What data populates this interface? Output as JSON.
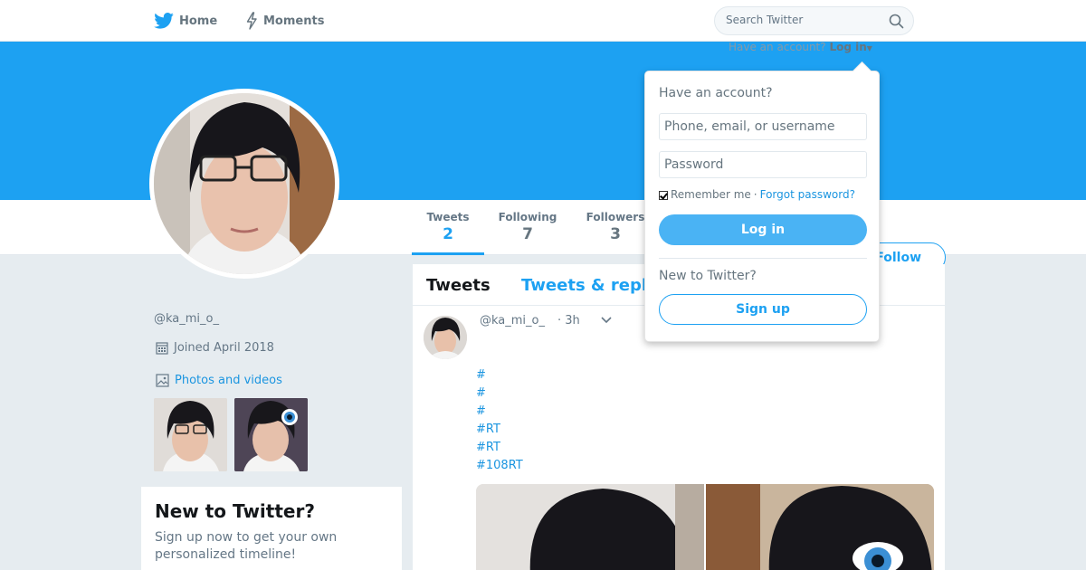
{
  "nav": {
    "home_label": "Home",
    "moments_label": "Moments",
    "search_placeholder": "Search Twitter",
    "have_account_prefix": "Have an account?",
    "login_label": "Log in"
  },
  "profile": {
    "display_name": "ㅤㅤ",
    "handle": "@ka_mi_o_",
    "joined": "Joined April 2018",
    "photos_link": "Photos and videos",
    "banner_color": "#1da1f2"
  },
  "stats": [
    {
      "label": "Tweets",
      "value": "2"
    },
    {
      "label": "Following",
      "value": "7"
    },
    {
      "label": "Followers",
      "value": "3"
    }
  ],
  "follow_button": "Follow",
  "new_card": {
    "title": "New to Twitter?",
    "text": "Sign up now to get your own personalized timeline!"
  },
  "timeline": {
    "tab_tweets": "Tweets",
    "tab_replies": "Tweets & replies",
    "tweet": {
      "handle": "@ka_mi_o_",
      "time": "· 3h",
      "lines": [
        "#",
        "#",
        "#",
        "#RT",
        "#RT",
        "#108RT"
      ]
    }
  },
  "login_dropdown": {
    "heading": "Have an account?",
    "username_placeholder": "Phone, email, or username",
    "password_placeholder": "Password",
    "remember": "Remember me",
    "separator": "·",
    "forgot": "Forgot password?",
    "login_button": "Log in",
    "new_heading": "New to Twitter?",
    "signup_button": "Sign up"
  },
  "colors": {
    "accent": "#1da1f2",
    "link": "#1b95e0",
    "login_button_bg": "#4ab3f4"
  }
}
